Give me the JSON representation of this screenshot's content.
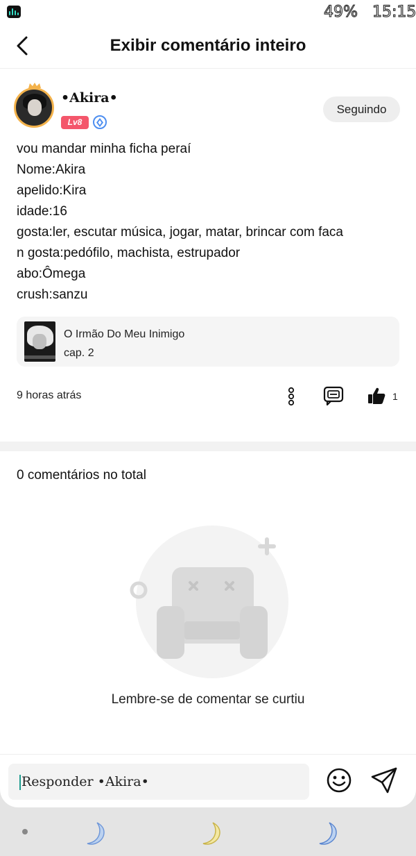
{
  "status_bar": {
    "battery": "49%",
    "time": "15:15"
  },
  "header": {
    "title": "Exibir comentário inteiro"
  },
  "author": {
    "name": "•Akira•",
    "level": "Lv8",
    "follow_label": "Seguindo"
  },
  "comment": {
    "lines": [
      "vou mandar minha ficha peraí",
      "Nome:Akira",
      "apelido:Kira",
      "idade:16",
      "gosta:ler, escutar música, jogar, matar, brincar com faca",
      "n gosta:pedófilo, machista, estrupador",
      "abo:Ômega",
      "crush:sanzu"
    ]
  },
  "story": {
    "title": "O Irmão Do Meu Inimigo",
    "chapter": "cap. 2"
  },
  "actions": {
    "timestamp": "9 horas atrás",
    "like_count": "1"
  },
  "comments": {
    "total_label": "0 comentários no total",
    "empty_message": "Lembre-se de comentar se curtiu"
  },
  "reply": {
    "placeholder": "Responder •Akira•"
  },
  "colors": {
    "level_badge": "#f4566b",
    "verified": "#4d8ef0",
    "accent_caret": "#1d9c8f"
  },
  "icons": [
    "back-icon",
    "more-icon",
    "reply-icon",
    "like-icon",
    "emoji-icon",
    "send-icon",
    "moon-icon"
  ]
}
